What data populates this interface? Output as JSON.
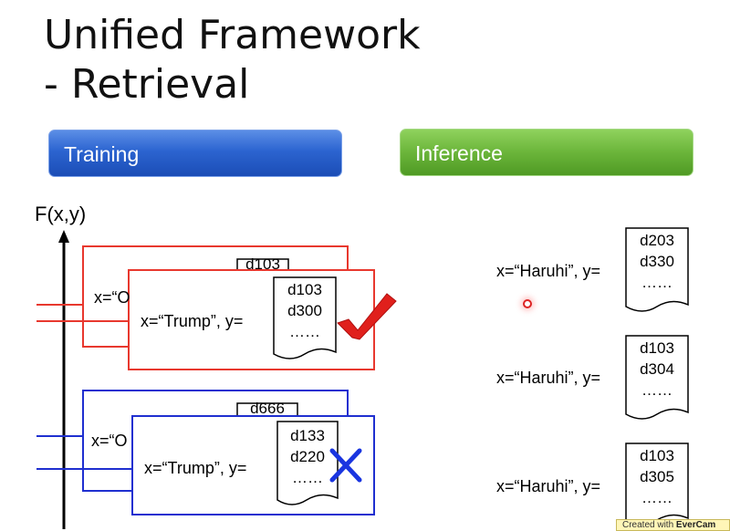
{
  "title": {
    "line1": "Unified Framework",
    "line2": "- Retrieval"
  },
  "headers": {
    "training": "Training",
    "inference": "Inference"
  },
  "axis_label": "F(x,y)",
  "training": {
    "red_back": {
      "x_label": "x=“O",
      "doc_top": "d103"
    },
    "red_front": {
      "x_label": "x=“Trump”, y=",
      "doc": [
        "d103",
        "d300",
        "……"
      ],
      "mark": "check"
    },
    "blue_back": {
      "x_label": "x=“O",
      "doc_top": "d666"
    },
    "blue_front": {
      "x_label": "x=“Trump”, y=",
      "doc": [
        "d133",
        "d220",
        "……"
      ],
      "mark": "cross"
    }
  },
  "inference": [
    {
      "x_label": "x=“Haruhi”,  y=",
      "doc": [
        "d203",
        "d330",
        "……"
      ]
    },
    {
      "x_label": "x=“Haruhi”,  y=",
      "doc": [
        "d103",
        "d304",
        "……"
      ]
    },
    {
      "x_label": "x=“Haruhi”,  y=",
      "doc": [
        "d103",
        "d305",
        "……"
      ]
    }
  ],
  "colors": {
    "red": "#e8382e",
    "blue": "#1f2fd0",
    "check": "#e0201c",
    "cross": "#1a35e0"
  },
  "watermark": {
    "prefix": "Created with",
    "brand": "EverCam"
  }
}
